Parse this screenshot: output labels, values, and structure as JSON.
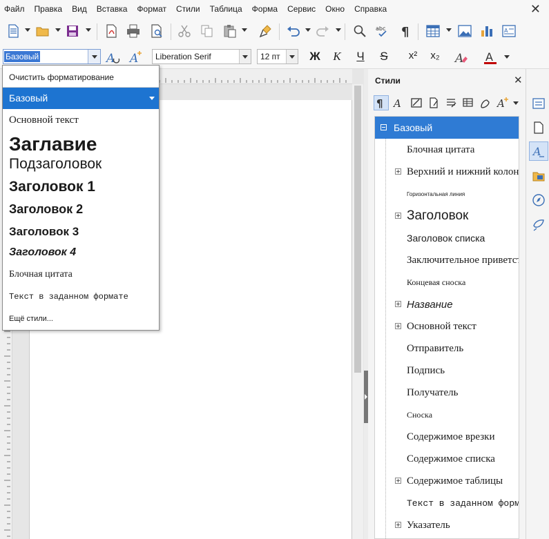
{
  "menu": [
    "Файл",
    "Правка",
    "Вид",
    "Вставка",
    "Формат",
    "Стили",
    "Таблица",
    "Форма",
    "Сервис",
    "Окно",
    "Справка"
  ],
  "window": {
    "close_glyph": "✕"
  },
  "toolbar2": {
    "paragraph_style": "Базовый",
    "font_name": "Liberation Serif",
    "font_size": "12 пт",
    "bold": "Ж",
    "italic": "К",
    "underline": "Ч",
    "strike": "S",
    "superscript": "x²",
    "subscript": "x₂"
  },
  "style_dropdown": {
    "clear_formatting": "Очистить форматирование",
    "selected": "Базовый",
    "items": [
      "Основной текст",
      "Заглавие",
      "Подзаголовок",
      "Заголовок 1",
      "Заголовок 2",
      "Заголовок 3",
      "Заголовок 4",
      "Блочная цитата",
      "Текст в заданном формате"
    ],
    "more_styles": "Ещё стили..."
  },
  "sidebar": {
    "title": "Стили",
    "close_glyph": "✕",
    "menu_glyph": "⋮",
    "selected": "Базовый",
    "items": [
      "Блочная цитата",
      "Верхний и нижний колонтитулы",
      "Горизонтальная линия",
      "Заголовок",
      "Заголовок списка",
      "Заключительное приветствие",
      "Концевая сноска",
      "Название",
      "Основной текст",
      "Отправитель",
      "Подпись",
      "Получатель",
      "Сноска",
      "Содержимое врезки",
      "Содержимое списка",
      "Содержимое таблицы",
      "Текст в заданном формате",
      "Указатель"
    ]
  },
  "icons": {
    "toolbar1": [
      "new-document-icon",
      "open-folder-icon",
      "save-icon",
      "export-pdf-icon",
      "print-icon",
      "print-preview-icon",
      "cut-icon",
      "copy-icon",
      "paste-icon",
      "clone-formatting-icon",
      "undo-icon",
      "redo-icon",
      "find-replace-icon",
      "spellcheck-icon",
      "formatting-marks-icon",
      "insert-table-icon",
      "insert-image-icon",
      "insert-chart-icon",
      "insert-textbox-icon"
    ],
    "deck": [
      "properties-icon",
      "page-icon",
      "styles-icon",
      "gallery-icon",
      "navigator-icon",
      "manage-changes-icon"
    ]
  },
  "colors": {
    "accent": "#2f7bd4",
    "font_color": "#c00000"
  }
}
